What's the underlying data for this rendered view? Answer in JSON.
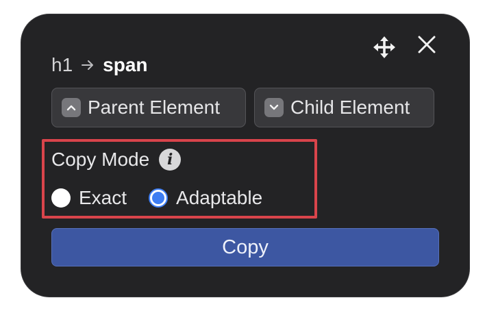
{
  "toolbar": {
    "move_icon": "move-arrows-icon",
    "close_icon": "close-icon"
  },
  "breadcrumb": {
    "parent": "h1",
    "separator_icon": "arrow-right-icon",
    "current": "span"
  },
  "navigation": {
    "parent_label": "Parent Element",
    "parent_icon": "chevron-up-icon",
    "child_label": "Child Element",
    "child_icon": "chevron-down-icon"
  },
  "copy_mode": {
    "title": "Copy Mode",
    "info_icon": "info-icon",
    "info_glyph": "i",
    "options": [
      {
        "label": "Exact",
        "selected": false
      },
      {
        "label": "Adaptable",
        "selected": true
      }
    ]
  },
  "copy_button": {
    "label": "Copy"
  },
  "colors": {
    "panel_bg": "#232325",
    "button_bg": "#38383b",
    "primary": "#3d57a2",
    "radio_accent": "#3d7df2",
    "highlight_border": "#d9444b"
  }
}
